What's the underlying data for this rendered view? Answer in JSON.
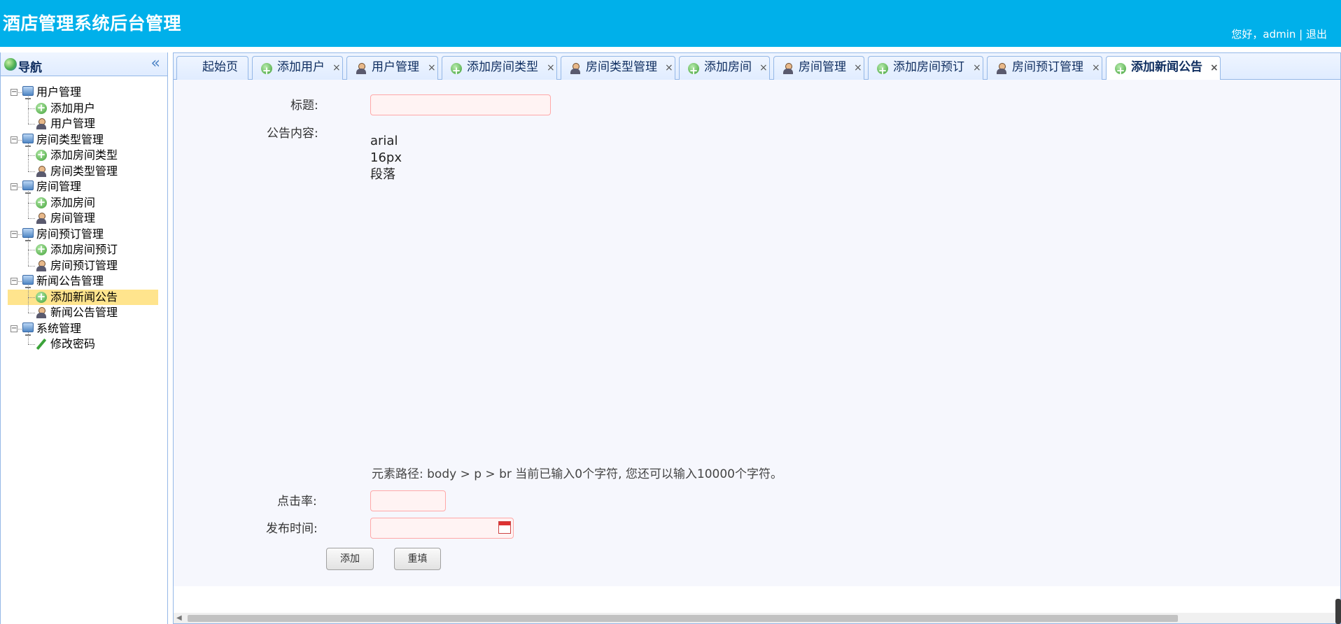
{
  "header": {
    "title": "酒店管理系统后台管理",
    "greeting": "您好，admin",
    "separator": " | ",
    "logout": "退出"
  },
  "nav": {
    "title": "导航",
    "collapse_glyph": "«",
    "tree": [
      {
        "label": "用户管理",
        "children": [
          {
            "label": "添加用户",
            "icon": "add-icon"
          },
          {
            "label": "用户管理",
            "icon": "user-icon"
          }
        ]
      },
      {
        "label": "房间类型管理",
        "children": [
          {
            "label": "添加房间类型",
            "icon": "add-icon"
          },
          {
            "label": "房间类型管理",
            "icon": "user-icon"
          }
        ]
      },
      {
        "label": "房间管理",
        "children": [
          {
            "label": "添加房间",
            "icon": "add-icon"
          },
          {
            "label": "房间管理",
            "icon": "user-icon"
          }
        ]
      },
      {
        "label": "房间预订管理",
        "children": [
          {
            "label": "添加房间预订",
            "icon": "add-icon"
          },
          {
            "label": "房间预订管理",
            "icon": "user-icon"
          }
        ]
      },
      {
        "label": "新闻公告管理",
        "children": [
          {
            "label": "添加新闻公告",
            "icon": "add-icon",
            "selected": true
          },
          {
            "label": "新闻公告管理",
            "icon": "user-icon"
          }
        ]
      },
      {
        "label": "系统管理",
        "children": [
          {
            "label": "修改密码",
            "icon": "pencil-icon"
          }
        ]
      }
    ]
  },
  "tabs": [
    {
      "label": "起始页",
      "icon": "",
      "closable": false
    },
    {
      "label": "添加用户",
      "icon": "add-icon",
      "closable": true
    },
    {
      "label": "用户管理",
      "icon": "user-icon",
      "closable": true
    },
    {
      "label": "添加房间类型",
      "icon": "add-icon",
      "closable": true
    },
    {
      "label": "房间类型管理",
      "icon": "user-icon",
      "closable": true
    },
    {
      "label": "添加房间",
      "icon": "add-icon",
      "closable": true
    },
    {
      "label": "房间管理",
      "icon": "user-icon",
      "closable": true
    },
    {
      "label": "添加房间预订",
      "icon": "add-icon",
      "closable": true
    },
    {
      "label": "房间预订管理",
      "icon": "user-icon",
      "closable": true
    },
    {
      "label": "添加新闻公告",
      "icon": "add-icon",
      "closable": true,
      "active": true
    }
  ],
  "tab_close_glyph": "×",
  "form": {
    "title_label": "标题:",
    "title_value": "",
    "content_label": "公告内容:",
    "editor_lines": [
      "arial",
      "16px",
      "段落"
    ],
    "editor_status": "元素路径: body > p > br 当前已输入0个字符, 您还可以输入10000个字符。",
    "clicks_label": "点击率:",
    "clicks_value": "",
    "date_label": "发布时间:",
    "date_value": "",
    "submit_label": "添加",
    "reset_label": "重填"
  }
}
